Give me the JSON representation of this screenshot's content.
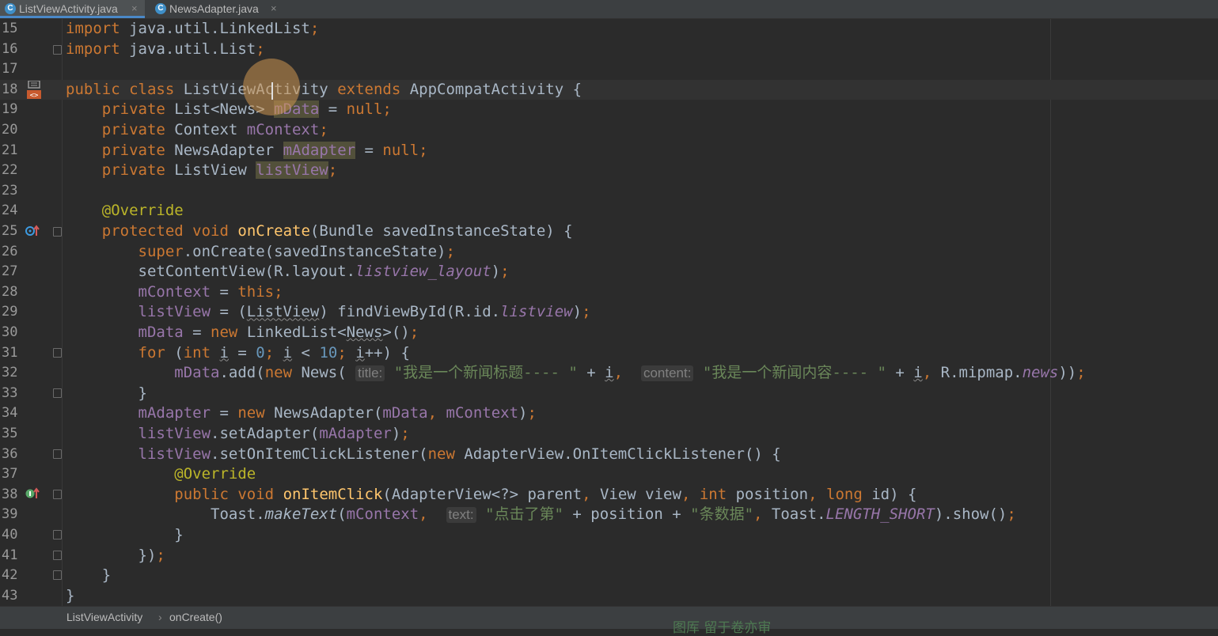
{
  "tabs": [
    {
      "label": "ListViewActivity.java",
      "icon": "java-class-icon",
      "active": true
    },
    {
      "label": "NewsAdapter.java",
      "icon": "java-class-icon",
      "active": false
    }
  ],
  "tab_icon_letter": "C",
  "tab_close_glyph": "×",
  "editor": {
    "line_numbers": [
      "15",
      "16",
      "17",
      "18",
      "19",
      "20",
      "21",
      "22",
      "23",
      "24",
      "25",
      "26",
      "27",
      "28",
      "29",
      "30",
      "31",
      "32",
      "33",
      "34",
      "35",
      "36",
      "37",
      "38",
      "39",
      "40",
      "41",
      "42",
      "43"
    ]
  },
  "breadcrumb": {
    "class_name": "ListViewActivity",
    "method_name": "onCreate()",
    "separator": "›"
  },
  "watermark": "图厍 留于卷亦审",
  "colors": {
    "background": "#2b2b2b",
    "keyword": "#cc7832",
    "field": "#9876aa",
    "string": "#6a8759",
    "number": "#6897bb",
    "annotation": "#bbb529",
    "method_decl": "#ffc66d",
    "default_text": "#a9b7c6"
  }
}
